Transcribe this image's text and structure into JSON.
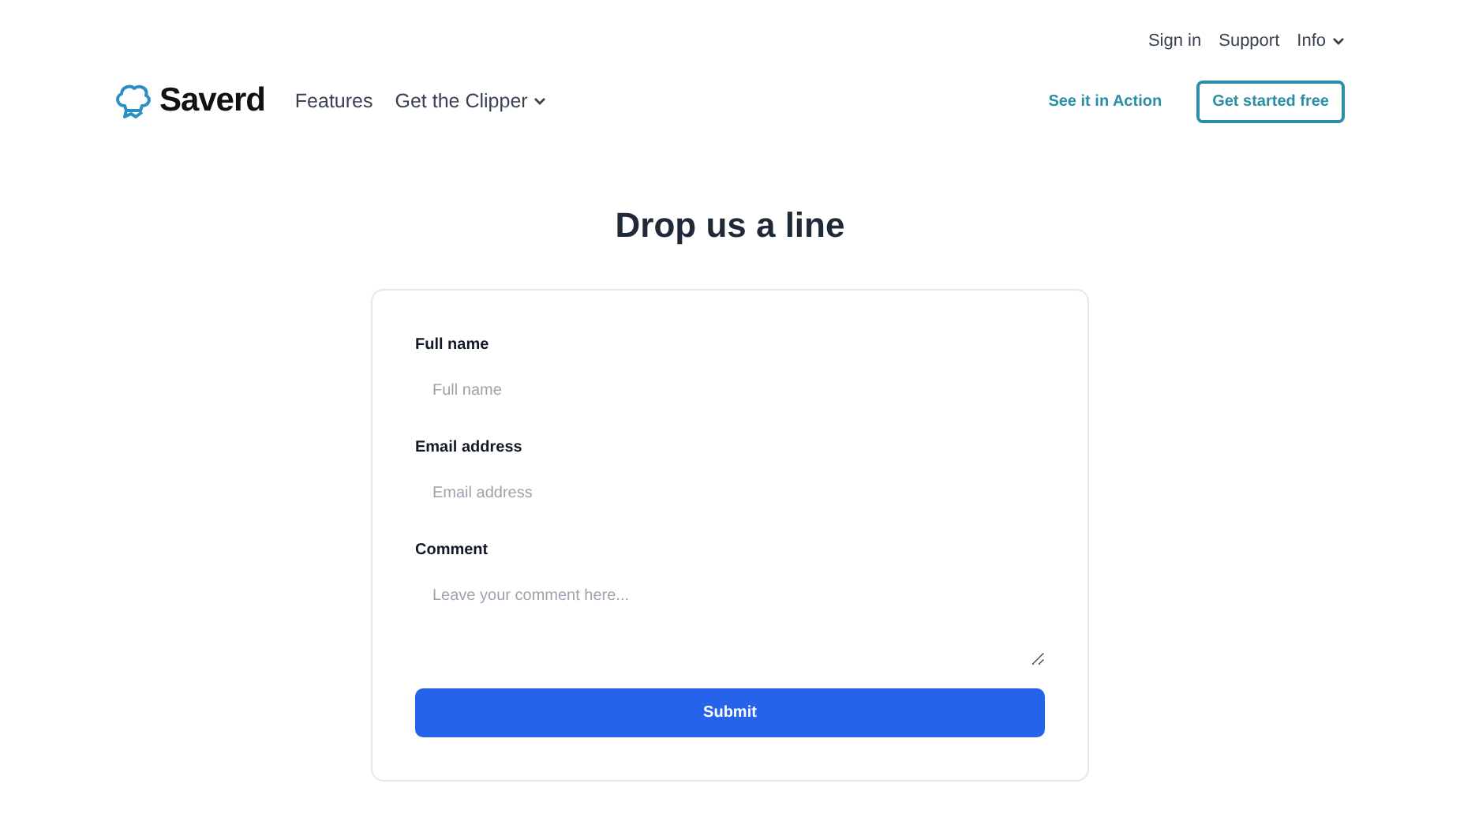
{
  "top_links": [
    {
      "label": "Sign in",
      "has_menu": false
    },
    {
      "label": "Support",
      "has_menu": false
    },
    {
      "label": "Info",
      "has_menu": true
    }
  ],
  "brand": {
    "name": "Saverd"
  },
  "nav": [
    {
      "label": "Features",
      "has_menu": false
    },
    {
      "label": "Get the Clipper",
      "has_menu": true
    }
  ],
  "actions": [
    {
      "label": "See it in Action",
      "kind": "link"
    },
    {
      "label": "Get started free",
      "kind": "outline"
    }
  ],
  "heading": "Drop us a line",
  "form": {
    "fields": [
      {
        "label": "Full name",
        "placeholder": "Full name",
        "kind": "input"
      },
      {
        "label": "Email address",
        "placeholder": "Email address",
        "kind": "input"
      },
      {
        "label": "Comment",
        "placeholder": "Leave your comment here...",
        "kind": "textarea"
      }
    ],
    "submit": "Submit"
  }
}
